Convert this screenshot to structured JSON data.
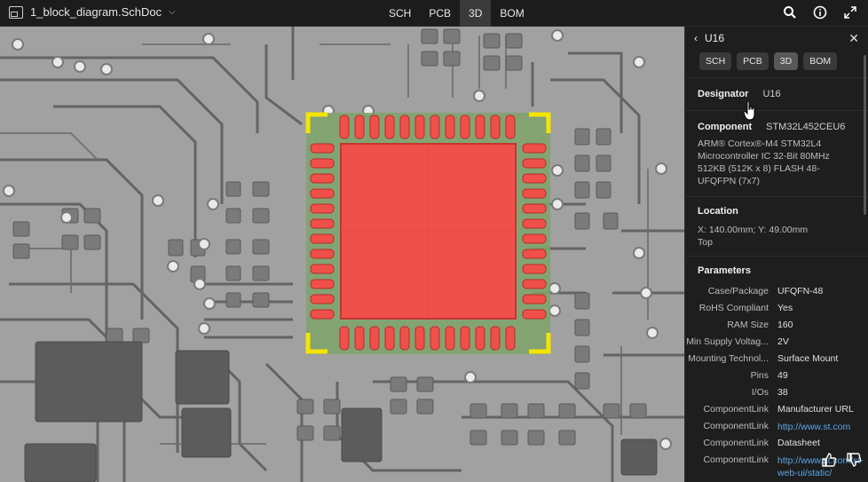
{
  "topbar": {
    "doc_name": "1_block_diagram.SchDoc",
    "doc_icon": "document-icon",
    "tabs": [
      {
        "label": "SCH",
        "active": false
      },
      {
        "label": "PCB",
        "active": false
      },
      {
        "label": "3D",
        "active": true
      },
      {
        "label": "BOM",
        "active": false
      }
    ],
    "icons": [
      "search-icon",
      "info-icon",
      "expand-icon"
    ]
  },
  "colors": {
    "accent_component": "#f0504a",
    "board": "#9a9a9a",
    "trace": "#606060",
    "panel_bg": "#1e1e1e",
    "link": "#59a7e6",
    "corner_marker": "#f4e400"
  },
  "panel": {
    "title": "U16",
    "back_icon": "chevron-left-icon",
    "close_icon": "close-icon",
    "tabs": [
      {
        "label": "SCH",
        "active": false
      },
      {
        "label": "PCB",
        "active": false
      },
      {
        "label": "3D",
        "active": true
      },
      {
        "label": "BOM",
        "active": false
      }
    ],
    "designator_label": "Designator",
    "designator_value": "U16",
    "component_label": "Component",
    "component_value": "STM32L452CEU6",
    "component_desc": "ARM® Cortex®-M4 STM32L4 Microcontroller IC 32-Bit 80MHz 512KB (512K x 8) FLASH 48-UFQFPN (7x7)",
    "location_title": "Location",
    "location_xy": "X: 140.00mm; Y: 49.00mm",
    "location_side": "Top",
    "parameters_title": "Parameters",
    "parameters": [
      {
        "key": "Case/Package",
        "value": "UFQFN-48",
        "link": false
      },
      {
        "key": "RoHS Compliant",
        "value": "Yes",
        "link": false
      },
      {
        "key": "RAM Size",
        "value": "160",
        "link": false
      },
      {
        "key": "Min Supply Voltag...",
        "value": "2V",
        "link": false
      },
      {
        "key": "Mounting Technol...",
        "value": "Surface Mount",
        "link": false
      },
      {
        "key": "Pins",
        "value": "49",
        "link": false
      },
      {
        "key": "I/Os",
        "value": "38",
        "link": false
      },
      {
        "key": "ComponentLink",
        "value": "Manufacturer URL",
        "link": false
      },
      {
        "key": "ComponentLink",
        "value": "http://www.st.com",
        "link": true
      },
      {
        "key": "ComponentLink",
        "value": "Datasheet",
        "link": false
      },
      {
        "key": "ComponentLink",
        "value": "http://www.st.com/st-web-ui/static/",
        "link": true
      }
    ]
  },
  "feedback_icons": [
    "thumbs-up-icon",
    "thumbs-down-icon"
  ]
}
